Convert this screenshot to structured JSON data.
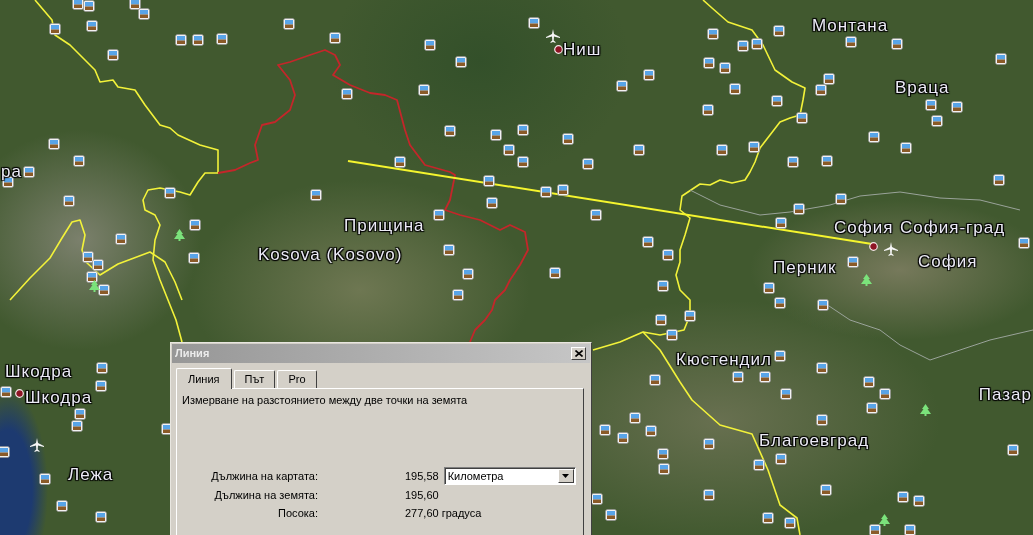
{
  "map": {
    "labels": [
      "Монтана",
      "Ниш",
      "Враца",
      "ра",
      "Прищина",
      "София",
      "София-град",
      "Kosova (Kosovo)",
      "София",
      "Перник",
      "Кюстендил",
      "Шкодра",
      "Пазар",
      "Шкодра",
      "Благоевград",
      "Лежа"
    ]
  },
  "dialog": {
    "title": "Линия",
    "tabs": [
      {
        "label": "Линия",
        "selected": true
      },
      {
        "label": "Път",
        "selected": false
      },
      {
        "label": "Pro",
        "selected": false
      }
    ],
    "description": "Измерване на разстоянието между две точки на земята",
    "measurements": [
      {
        "label": "Дължина на картата:",
        "value": "195,58",
        "unit": "Километра"
      },
      {
        "label": "Дължина на земята:",
        "value": "195,60"
      },
      {
        "label": "Посока:",
        "value": "277,60 градуса"
      }
    ]
  }
}
